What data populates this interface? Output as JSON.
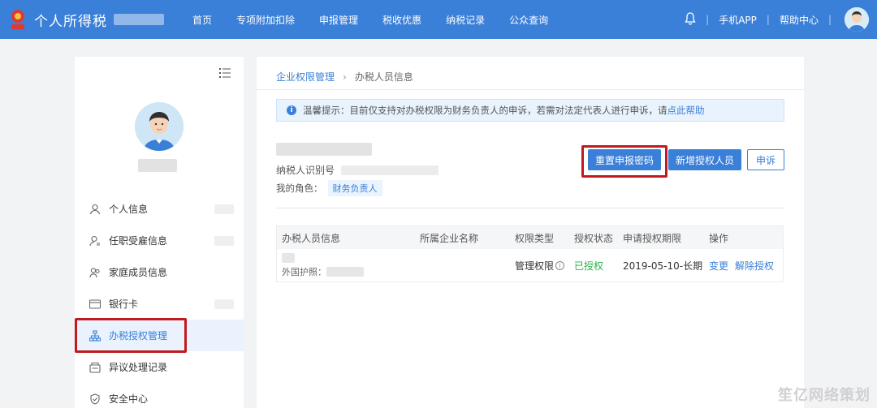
{
  "topbar": {
    "brand": "个人所得税",
    "nav": [
      "首页",
      "专项附加扣除",
      "申报管理",
      "税收优惠",
      "纳税记录",
      "公众查询"
    ],
    "mobile_app": "手机APP",
    "help_center": "帮助中心",
    "sep": "|"
  },
  "sidebar": {
    "items": [
      {
        "label": "个人信息",
        "icon": "user-icon"
      },
      {
        "label": "任职受雇信息",
        "icon": "employment-icon"
      },
      {
        "label": "家庭成员信息",
        "icon": "family-icon"
      },
      {
        "label": "银行卡",
        "icon": "bank-card-icon"
      },
      {
        "label": "办税授权管理",
        "icon": "org-chart-icon"
      },
      {
        "label": "异议处理记录",
        "icon": "objection-icon"
      },
      {
        "label": "安全中心",
        "icon": "shield-icon"
      }
    ],
    "active_index": 4
  },
  "breadcrumb": {
    "parent": "企业权限管理",
    "current": "办税人员信息"
  },
  "notice": {
    "text": "温馨提示：目前仅支持对办税权限为财务负责人的申诉，若需对法定代表人进行申诉，请",
    "link": "点此帮助"
  },
  "info": {
    "taxpayer_id_label": "纳税人识别号",
    "role_label": "我的角色：",
    "role_value": "财务负责人"
  },
  "buttons": {
    "reset": "重置申报密码",
    "add": "新增授权人员",
    "appeal": "申诉"
  },
  "table": {
    "headers": [
      "办税人员信息",
      "所属企业名称",
      "权限类型",
      "授权状态",
      "申请授权期限",
      "操作"
    ],
    "rows": [
      {
        "id_type": "外国护照：",
        "permission": "管理权限",
        "status": "已授权",
        "period": "2019-05-10-长期",
        "ops": [
          "变更",
          "解除授权"
        ]
      }
    ]
  },
  "watermark": "笙亿网络策划",
  "colors": {
    "brand_blue": "#3a7fd8",
    "highlight_red": "#c0191f",
    "status_green": "#2bb24c"
  }
}
